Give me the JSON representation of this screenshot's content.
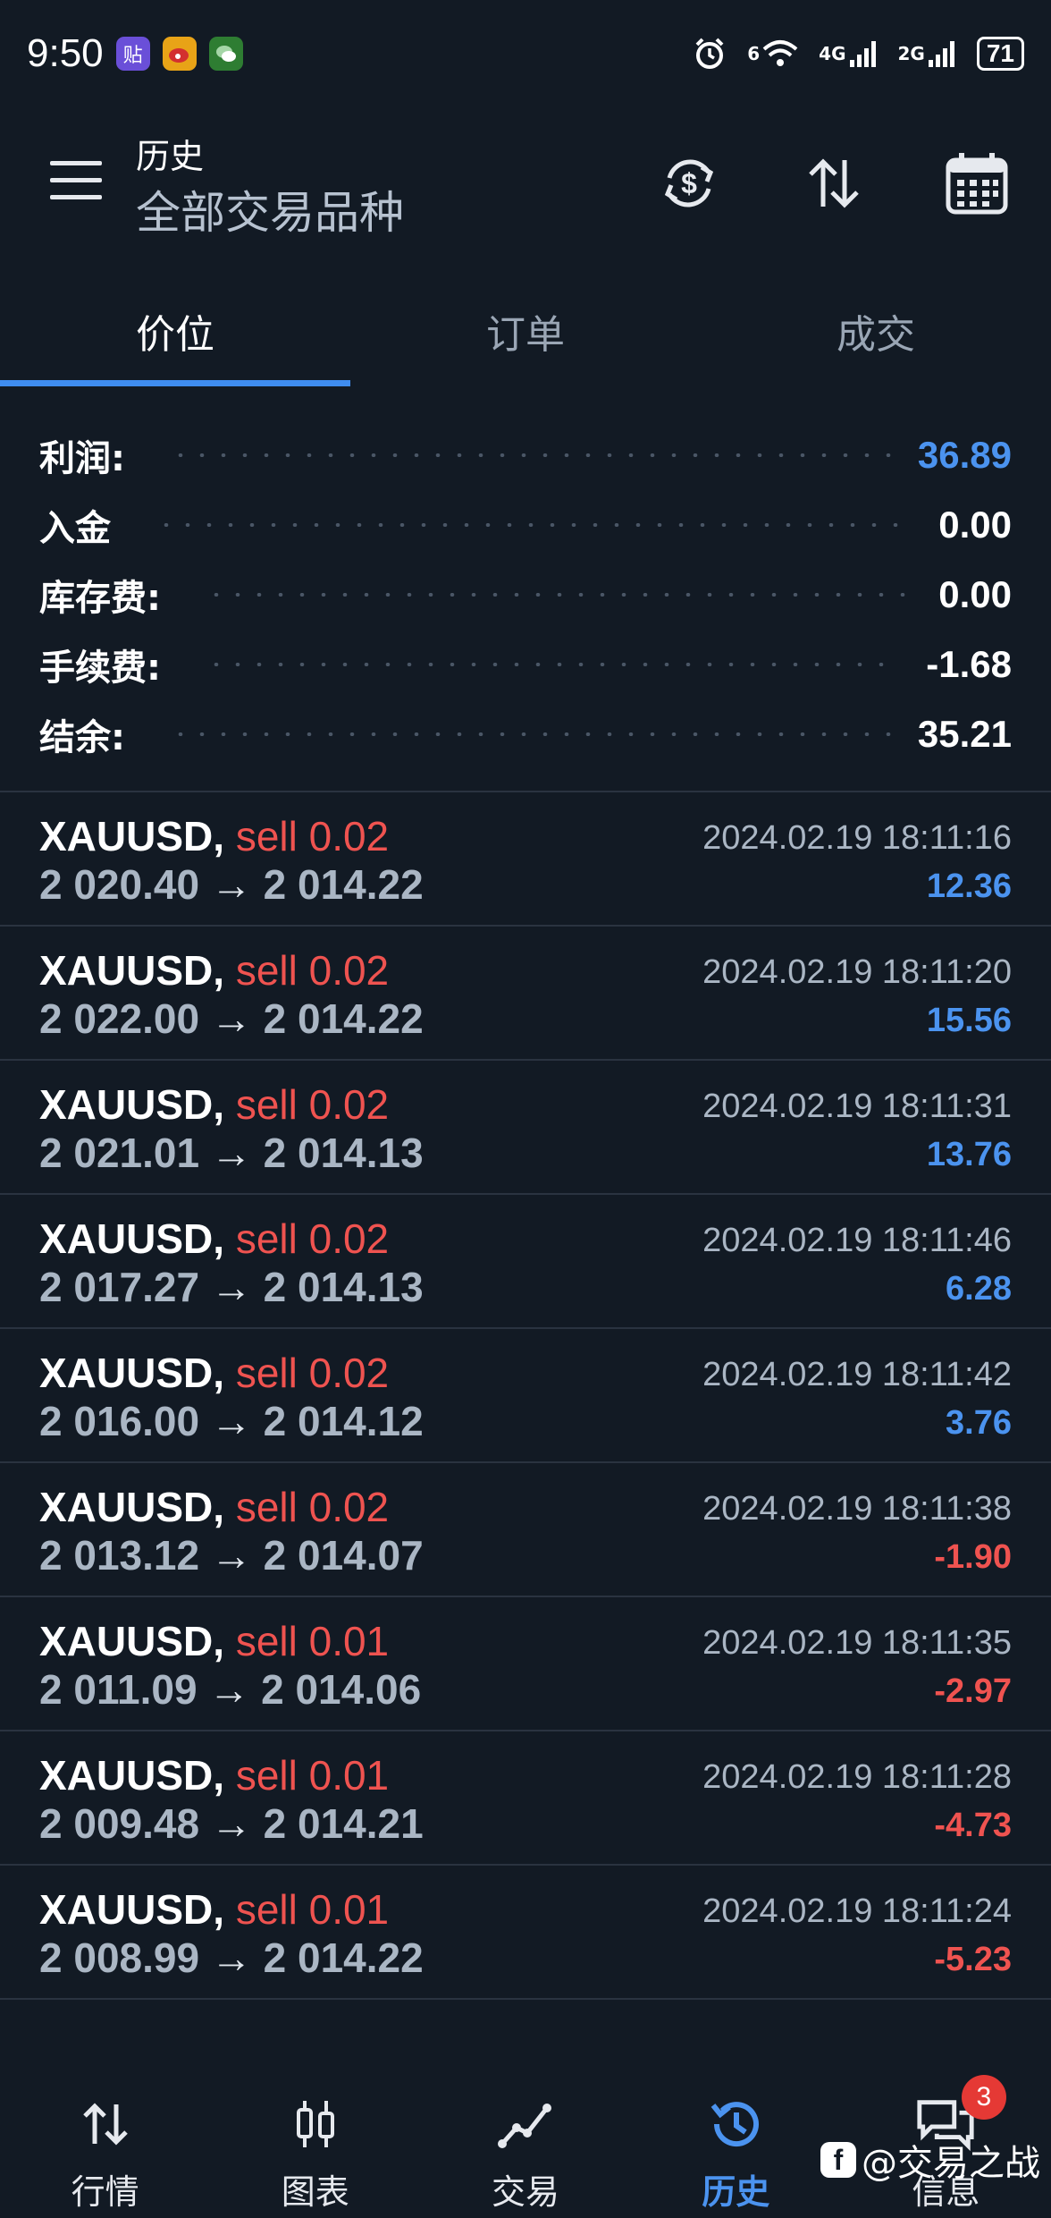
{
  "status_bar": {
    "time": "9:50",
    "app_icon_labels": [
      "贴",
      "",
      ""
    ],
    "network_4g": "4G",
    "network_2g": "2G",
    "wifi_tag": "6",
    "battery": "71"
  },
  "header": {
    "title": "历史",
    "subtitle": "全部交易品种",
    "icons": [
      "currency-refresh-icon",
      "sort-icon",
      "calendar-icon"
    ]
  },
  "tabs": [
    {
      "label": "价位",
      "active": true
    },
    {
      "label": "订单",
      "active": false
    },
    {
      "label": "成交",
      "active": false
    }
  ],
  "summary": [
    {
      "label": "利润:",
      "value": "36.89",
      "color": "#4b93ef"
    },
    {
      "label": "入金",
      "value": "0.00",
      "color": "#ffffff"
    },
    {
      "label": "库存费:",
      "value": "0.00",
      "color": "#ffffff"
    },
    {
      "label": "手续费:",
      "value": "-1.68",
      "color": "#ffffff"
    },
    {
      "label": "结余:",
      "value": "35.21",
      "color": "#ffffff"
    }
  ],
  "deals": [
    {
      "symbol": "XAUUSD,",
      "side": "sell 0.02",
      "open": "2 020.40",
      "arrow": "→",
      "close": "2 014.22",
      "time": "2024.02.19 18:11:16",
      "profit": "12.36",
      "positive": true
    },
    {
      "symbol": "XAUUSD,",
      "side": "sell 0.02",
      "open": "2 022.00",
      "arrow": "→",
      "close": "2 014.22",
      "time": "2024.02.19 18:11:20",
      "profit": "15.56",
      "positive": true
    },
    {
      "symbol": "XAUUSD,",
      "side": "sell 0.02",
      "open": "2 021.01",
      "arrow": "→",
      "close": "2 014.13",
      "time": "2024.02.19 18:11:31",
      "profit": "13.76",
      "positive": true
    },
    {
      "symbol": "XAUUSD,",
      "side": "sell 0.02",
      "open": "2 017.27",
      "arrow": "→",
      "close": "2 014.13",
      "time": "2024.02.19 18:11:46",
      "profit": "6.28",
      "positive": true
    },
    {
      "symbol": "XAUUSD,",
      "side": "sell 0.02",
      "open": "2 016.00",
      "arrow": "→",
      "close": "2 014.12",
      "time": "2024.02.19 18:11:42",
      "profit": "3.76",
      "positive": true
    },
    {
      "symbol": "XAUUSD,",
      "side": "sell 0.02",
      "open": "2 013.12",
      "arrow": "→",
      "close": "2 014.07",
      "time": "2024.02.19 18:11:38",
      "profit": "-1.90",
      "positive": false
    },
    {
      "symbol": "XAUUSD,",
      "side": "sell 0.01",
      "open": "2 011.09",
      "arrow": "→",
      "close": "2 014.06",
      "time": "2024.02.19 18:11:35",
      "profit": "-2.97",
      "positive": false
    },
    {
      "symbol": "XAUUSD,",
      "side": "sell 0.01",
      "open": "2 009.48",
      "arrow": "→",
      "close": "2 014.21",
      "time": "2024.02.19 18:11:28",
      "profit": "-4.73",
      "positive": false
    },
    {
      "symbol": "XAUUSD,",
      "side": "sell 0.01",
      "open": "2 008.99",
      "arrow": "→",
      "close": "2 014.22",
      "time": "2024.02.19 18:11:24",
      "profit": "-5.23",
      "positive": false
    }
  ],
  "bottom_nav": [
    {
      "label": "行情",
      "icon": "quotes-icon",
      "active": false
    },
    {
      "label": "图表",
      "icon": "chart-icon",
      "active": false
    },
    {
      "label": "交易",
      "icon": "trade-icon",
      "active": false
    },
    {
      "label": "历史",
      "icon": "history-icon",
      "active": true
    },
    {
      "label": "信息",
      "icon": "messages-icon",
      "active": false,
      "badge": "3"
    }
  ],
  "watermark": {
    "text": "@交易之战"
  },
  "colors": {
    "background": "#121a24",
    "accent_blue": "#4b93ef",
    "sell_red": "#ef5350",
    "divider": "#2a3340"
  }
}
